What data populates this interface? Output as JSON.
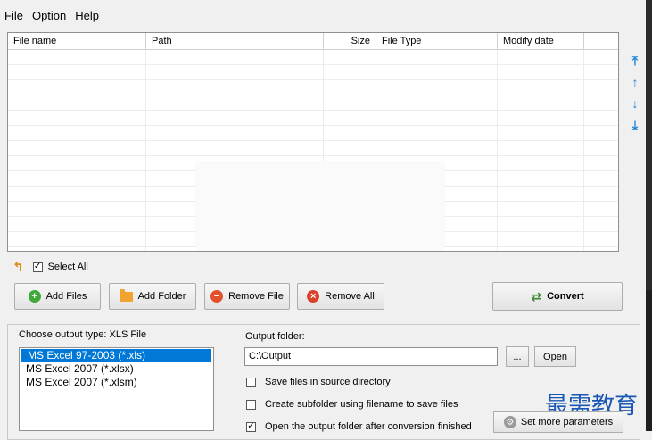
{
  "menu": [
    "File",
    "Option",
    "Help"
  ],
  "file_list": {
    "columns": [
      "File name",
      "Path",
      "Size",
      "File Type",
      "Modify date"
    ],
    "rows": []
  },
  "side_arrows": [
    "move-top",
    "move-up",
    "move-down",
    "move-bottom"
  ],
  "select_all": {
    "label": "Select All",
    "checked": true
  },
  "buttons": {
    "add_files": "Add Files",
    "add_folder": "Add Folder",
    "remove_file": "Remove File",
    "remove_all": "Remove All",
    "convert": "Convert"
  },
  "output_type": {
    "label": "Choose output type:  XLS File",
    "options": [
      "MS Excel 97-2003 (*.xls)",
      "MS Excel 2007 (*.xlsx)",
      "MS Excel 2007 (*.xlsm)"
    ],
    "selected_index": 0
  },
  "output_folder": {
    "label": "Output folder:",
    "value": "C:\\Output",
    "browse_label": "...",
    "open_label": "Open"
  },
  "options": [
    {
      "label": "Save files in source directory",
      "checked": false
    },
    {
      "label": "Create subfolder using filename to save files",
      "checked": false
    },
    {
      "label": "Open the output folder after conversion finished",
      "checked": true
    }
  ],
  "more_params_label": "Set more parameters",
  "watermark": "最需教育",
  "colors": {
    "accent": "#0078d7",
    "arrow_blue": "#1e82d6",
    "watermark": "#1a57b5"
  }
}
